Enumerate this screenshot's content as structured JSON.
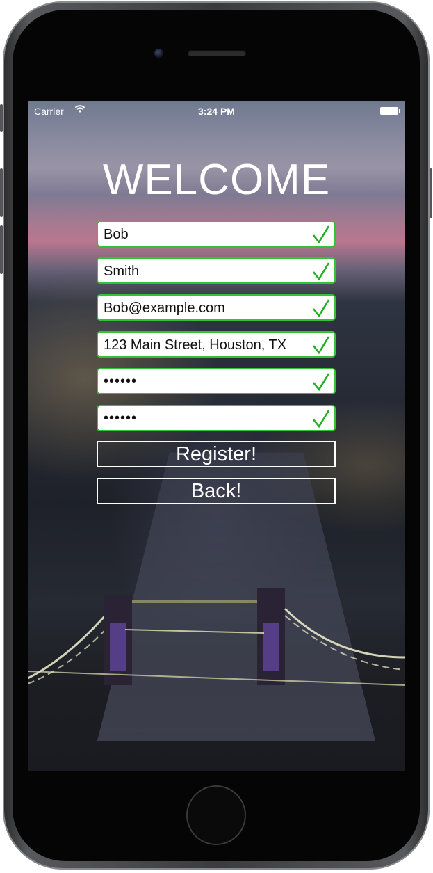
{
  "status_bar": {
    "carrier": "Carrier",
    "time": "3:24 PM"
  },
  "screen": {
    "title": "WELCOME",
    "fields": [
      {
        "value": "Bob",
        "valid": true
      },
      {
        "value": "Smith",
        "valid": true
      },
      {
        "value": "Bob@example.com",
        "valid": true
      },
      {
        "value": "123 Main Street, Houston, TX",
        "valid": true
      },
      {
        "value": "••••••",
        "valid": true
      },
      {
        "value": "••••••",
        "valid": true
      }
    ],
    "register_label": "Register!",
    "back_label": "Back!"
  },
  "colors": {
    "valid_border": "#33c233",
    "checkmark": "#22b022",
    "button_border": "#ffffff"
  },
  "icons": {
    "checkmark": "check-icon",
    "wifi": "wifi-icon",
    "battery": "battery-icon"
  }
}
